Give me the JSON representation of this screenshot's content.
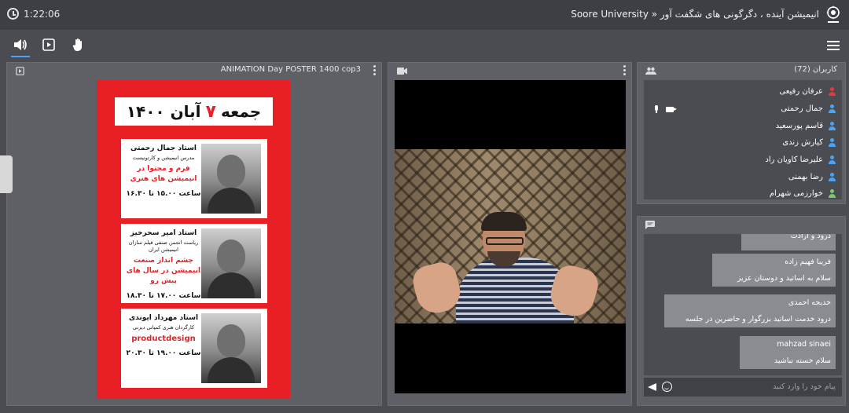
{
  "topbar": {
    "timer": "1:22:06",
    "title": "Soore University » انیمیشن آینده ، دگرگونی های شگفت آور"
  },
  "toolbar": {
    "icons": [
      "speaker-icon",
      "presentation-icon",
      "raise-hand-icon",
      "menu-icon"
    ]
  },
  "presentation_panel": {
    "title": "ANIMATION Day POSTER 1400 cop3",
    "poster": {
      "header_prefix": "جمعه",
      "header_num": "۷",
      "header_suffix": "آبان ۱۴۰۰",
      "speakers": [
        {
          "name": "استاد جمال رحمتی",
          "role": "مدرس انیمیشن و کارتونیست",
          "topic": "فرم و محتوا در انیمیشن های هنری",
          "time": "ساعت ۱۵.۰۰ تا ۱۶.۳۰"
        },
        {
          "name": "استاد امیر سحرخیز",
          "role": "ریاست انجمن صنفی فیلم سازان انیمیشن ایران",
          "topic": "چشم انداز صنعت انیمیشن در سال های پیش رو",
          "time": "ساعت ۱۷.۰۰ تا ۱۸.۳۰"
        },
        {
          "name": "استاد مهرداد ایوندی",
          "role": "کارگردان هنری کمپانی دیزنی",
          "topic": "productdesign",
          "time": "ساعت ۱۹.۰۰ تا ۲۰.۳۰"
        }
      ]
    }
  },
  "users_panel": {
    "title": "کاربران (72)",
    "users": [
      {
        "name": "عرفان رفیعی",
        "color": "#e53935"
      },
      {
        "name": "جمال رحمتی",
        "color": "#4aa3f5"
      },
      {
        "name": "قاسم پورسعید",
        "color": "#4aa3f5"
      },
      {
        "name": "کیارش زندی",
        "color": "#4aa3f5"
      },
      {
        "name": "علیرضا کاویان راد",
        "color": "#4aa3f5"
      },
      {
        "name": "رضا بهمنی",
        "color": "#4aa3f5"
      },
      {
        "name": "خوارزمی شهرام",
        "color": "#7cc96b"
      }
    ]
  },
  "chat_panel": {
    "messages": [
      {
        "lines": [
          "درود و ارادت"
        ]
      },
      {
        "lines": [
          "فریبا فهیم زاده",
          "سلام به اساتید و دوستان عزیز"
        ]
      },
      {
        "lines": [
          "خدیجه احمدی",
          "درود خدمت اساتید بزرگوار و حاضرین در جلسه"
        ]
      },
      {
        "lines": [
          "mahzad sinaei",
          "سلام خسته نباشید"
        ]
      }
    ],
    "input_placeholder": "پیام خود را وارد کنید"
  }
}
